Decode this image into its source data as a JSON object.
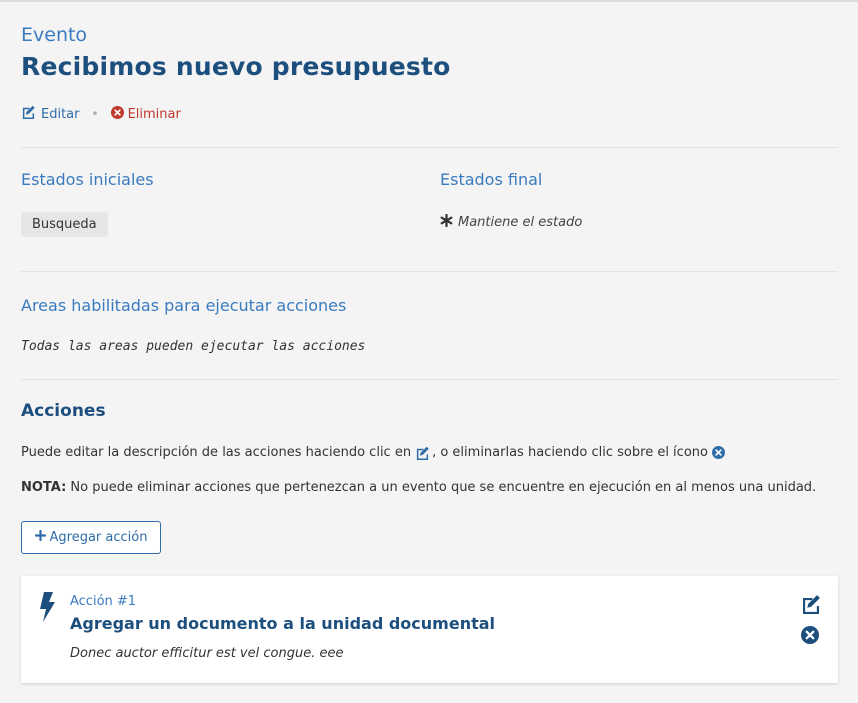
{
  "header": {
    "eyebrow": "Evento",
    "title": "Recibimos nuevo presupuesto",
    "edit_label": "Editar",
    "separator": "•",
    "delete_label": "Eliminar"
  },
  "states": {
    "initial_title": "Estados iniciales",
    "initial_items": [
      "Busqueda"
    ],
    "final_title": "Estados final",
    "final_value": "Mantiene el estado"
  },
  "areas": {
    "title": "Areas habilitadas para ejecutar acciones",
    "note": "Todas las areas pueden ejecutar las acciones"
  },
  "acciones": {
    "title": "Acciones",
    "help_before": "Puede editar la descripción de las acciones haciendo clic en",
    "help_middle": ", o eliminarlas haciendo clic sobre el ícono",
    "nota_label": "NOTA:",
    "nota_text": " No puede eliminar acciones que pertenezcan a un evento que se encuentre en ejecución en al menos una unidad.",
    "add_button": "Agregar acción",
    "items": [
      {
        "number": "Acción #1",
        "title": "Agregar un documento a la unidad documental",
        "description": "Donec auctor efficitur est vel congue. eee"
      }
    ]
  },
  "colors": {
    "primary": "#1d4f7e",
    "link": "#2f6da8",
    "danger": "#c0392b",
    "background": "#f4f4f4"
  }
}
